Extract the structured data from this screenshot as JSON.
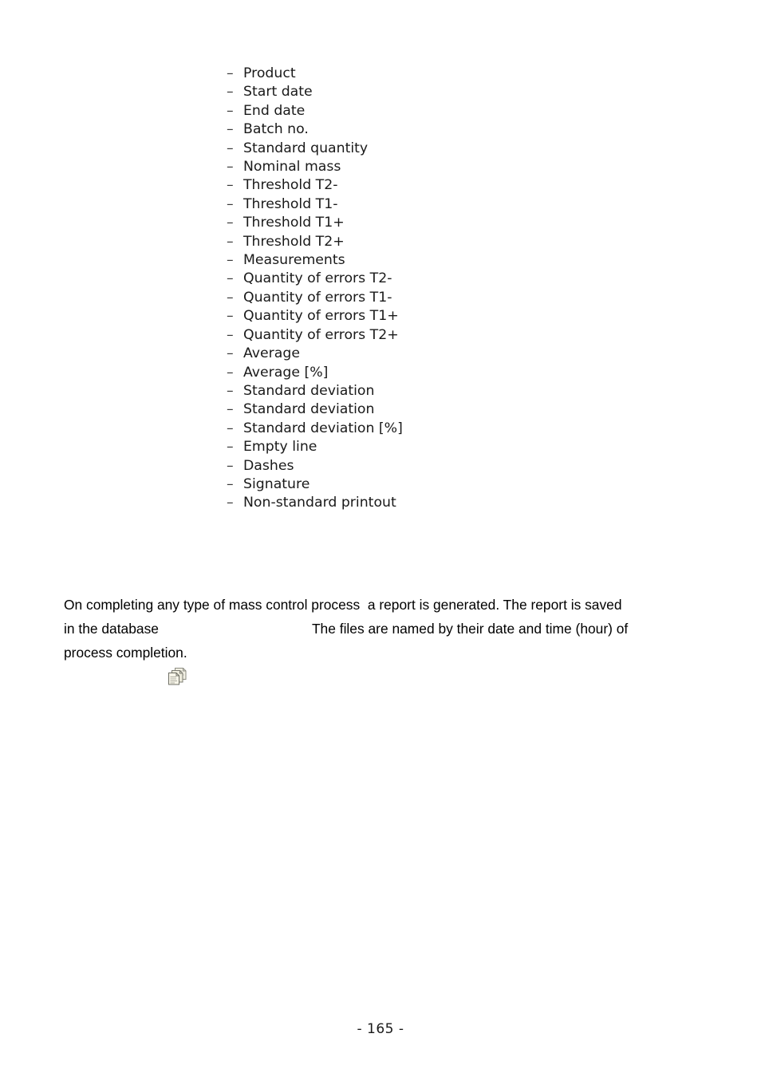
{
  "document": {
    "printout_fields_list": [
      {
        "marker": "–",
        "label": "Product"
      },
      {
        "marker": "–",
        "label": "Start date"
      },
      {
        "marker": "–",
        "label": "End date"
      },
      {
        "marker": "–",
        "label": "Batch no."
      },
      {
        "marker": "–",
        "label": "Standard quantity"
      },
      {
        "marker": "–",
        "label": "Nominal mass"
      },
      {
        "marker": "–",
        "label": "Threshold T2-"
      },
      {
        "marker": "–",
        "label": "Threshold T1-"
      },
      {
        "marker": "–",
        "label": "Threshold T1+"
      },
      {
        "marker": "–",
        "label": "Threshold T2+"
      },
      {
        "marker": "–",
        "label": "Measurements"
      },
      {
        "marker": "–",
        "label": "Quantity of errors T2-"
      },
      {
        "marker": "–",
        "label": "Quantity of errors T1-"
      },
      {
        "marker": "–",
        "label": "Quantity of errors T1+"
      },
      {
        "marker": "–",
        "label": "Quantity of errors T2+"
      },
      {
        "marker": "–",
        "label": "Average"
      },
      {
        "marker": "–",
        "label": "Average [%]"
      },
      {
        "marker": "–",
        "label": "Standard deviation"
      },
      {
        "marker": "–",
        "label": "Standard deviation"
      },
      {
        "marker": "–",
        "label": "Standard deviation [%]"
      },
      {
        "marker": "–",
        "label": "Empty line"
      },
      {
        "marker": "–",
        "label": "Dashes"
      },
      {
        "marker": "–",
        "label": "Signature"
      },
      {
        "marker": "–",
        "label": "Non-standard printout"
      }
    ],
    "paragraph": {
      "line1": "On completing any type of mass control process  a report is generated. The report is saved",
      "line2_before_icon": "in the database",
      "icon_name": "copy-documents-icon",
      "line2_after_icon": "The files are named by their date and time (hour) of",
      "line3": "process completion."
    },
    "footer": {
      "page_number": "- 165 -"
    }
  }
}
